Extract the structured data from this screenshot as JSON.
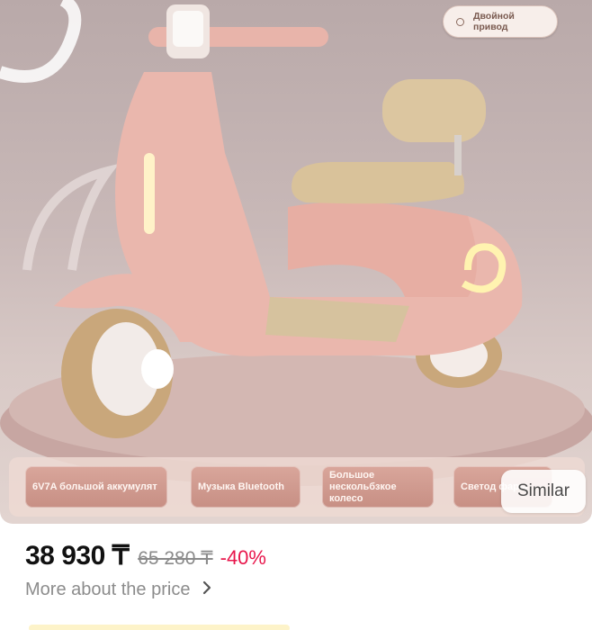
{
  "badge": {
    "label": "Двойной привод"
  },
  "features": [
    {
      "label": "6V7A большой аккумулят"
    },
    {
      "label": "Музыка Bluetooth"
    },
    {
      "label": "Большое нескольбзкое колесо"
    },
    {
      "label": "Светод фары"
    }
  ],
  "similar_label": "Similar",
  "price": {
    "current": "38 930 ₸",
    "old": "65 280 ₸",
    "discount": "-40%"
  },
  "more_price_label": "More about the price",
  "icons": {
    "chevron": "chevron-right-icon"
  },
  "colors": {
    "discount": "#e8164b",
    "accent_pink": "#d9a69b"
  }
}
